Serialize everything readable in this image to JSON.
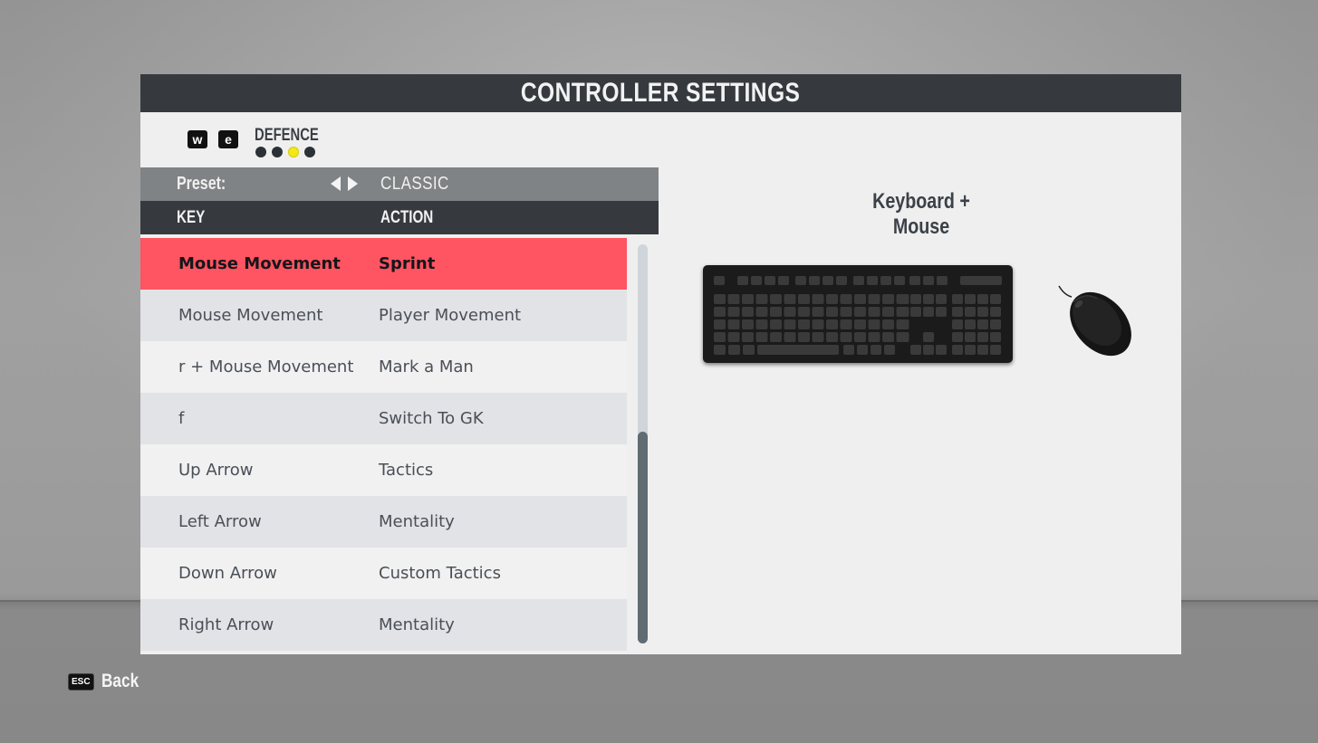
{
  "window": {
    "title": "CONTROLLER SETTINGS"
  },
  "mode_nav": {
    "prev_key": "w",
    "next_key": "e",
    "current_mode": "DEFENCE",
    "page_count": 4,
    "active_page": 3
  },
  "preset": {
    "label": "Preset:",
    "value": "CLASSIC",
    "prev_icon": "triangle-left-icon",
    "next_icon": "triangle-right-icon"
  },
  "table": {
    "columns": [
      "KEY",
      "ACTION"
    ],
    "rows": [
      {
        "key": "Mouse Movement",
        "action": "Sprint",
        "selected": true
      },
      {
        "key": "Mouse Movement",
        "action": "Player Movement",
        "selected": false
      },
      {
        "key": "r + Mouse Movement",
        "action": "Mark a Man",
        "selected": false
      },
      {
        "key": "f",
        "action": "Switch To GK",
        "selected": false
      },
      {
        "key": "Up Arrow",
        "action": "Tactics",
        "selected": false
      },
      {
        "key": "Left Arrow",
        "action": "Mentality",
        "selected": false
      },
      {
        "key": "Down Arrow",
        "action": "Custom Tactics",
        "selected": false
      },
      {
        "key": "Right Arrow",
        "action": "Mentality",
        "selected": false
      }
    ]
  },
  "scrollbar": {
    "thumb_start_fraction": 0.47,
    "thumb_size_fraction": 0.53
  },
  "device": {
    "title": "Keyboard + Mouse",
    "keyboard_icon": "keyboard-icon",
    "mouse_icon": "mouse-icon"
  },
  "footer": {
    "back_key": "ESC",
    "back_label": "Back"
  },
  "colors": {
    "header_bg": "#363a3f",
    "preset_bg": "#808385",
    "selected_row": "#ff5461",
    "active_dot": "#f2e81a",
    "panel_bg": "#efefef"
  }
}
